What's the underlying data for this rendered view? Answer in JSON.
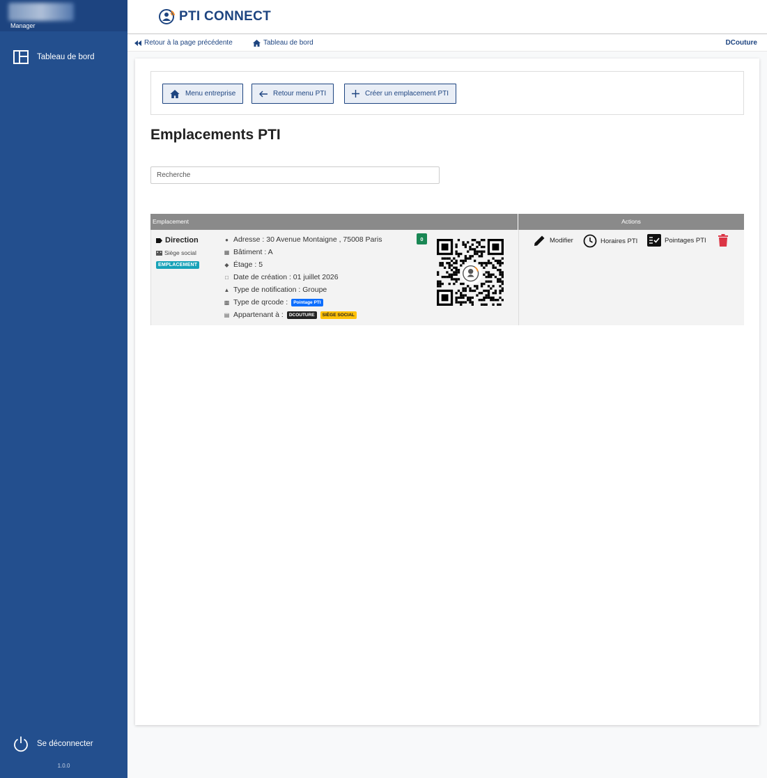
{
  "sidebar": {
    "role": "Manager",
    "nav": [
      {
        "label": "Tableau de bord",
        "icon": "dashboard-icon"
      }
    ],
    "logout_label": "Se déconnecter",
    "version": "1.0.0",
    "bg_color": "#234f8e"
  },
  "header": {
    "brand": "PTI CONNECT",
    "brand_icon": "shield-person-icon"
  },
  "breadcrumbs": {
    "back_label": "Retour à la page précédente",
    "dashboard_label": "Tableau de bord",
    "user": "DCouture"
  },
  "toolbar": {
    "company_menu_label": "Menu entreprise",
    "back_pti_label": "Retour menu PTI",
    "create_label": "Créer un emplacement PTI"
  },
  "page": {
    "title": "Emplacements PTI",
    "search_placeholder": "Recherche"
  },
  "table": {
    "columns": [
      "Emplacement",
      "Actions"
    ],
    "rows": [
      {
        "name": "Direction",
        "type": "Siège social",
        "badge": "EMPLACEMENT",
        "address": "Adresse : 30 Avenue Montaigne , 75008 Paris",
        "building": "Bâtiment : A",
        "floor": "Étage : 5",
        "created": "Date de création : 01 juillet 2026",
        "notification": "Type de notification : Groupe",
        "qr_type_label": "Type de qrcode :",
        "qr_type_badge": "Pointage PTI",
        "owner_label": "Appartenant à :",
        "owner_company": "DCOUTURE",
        "owner_site": "SIÈGE SOCIAL",
        "count": "0",
        "actions": {
          "edit": "Modifier",
          "schedules": "Horaires PTI",
          "checkins": "Pointages PTI"
        }
      }
    ]
  },
  "colors": {
    "primary": "#1d4480",
    "teal": "#17a2b8",
    "success": "#198754",
    "danger": "#dc3545",
    "warning": "#ffc107"
  }
}
